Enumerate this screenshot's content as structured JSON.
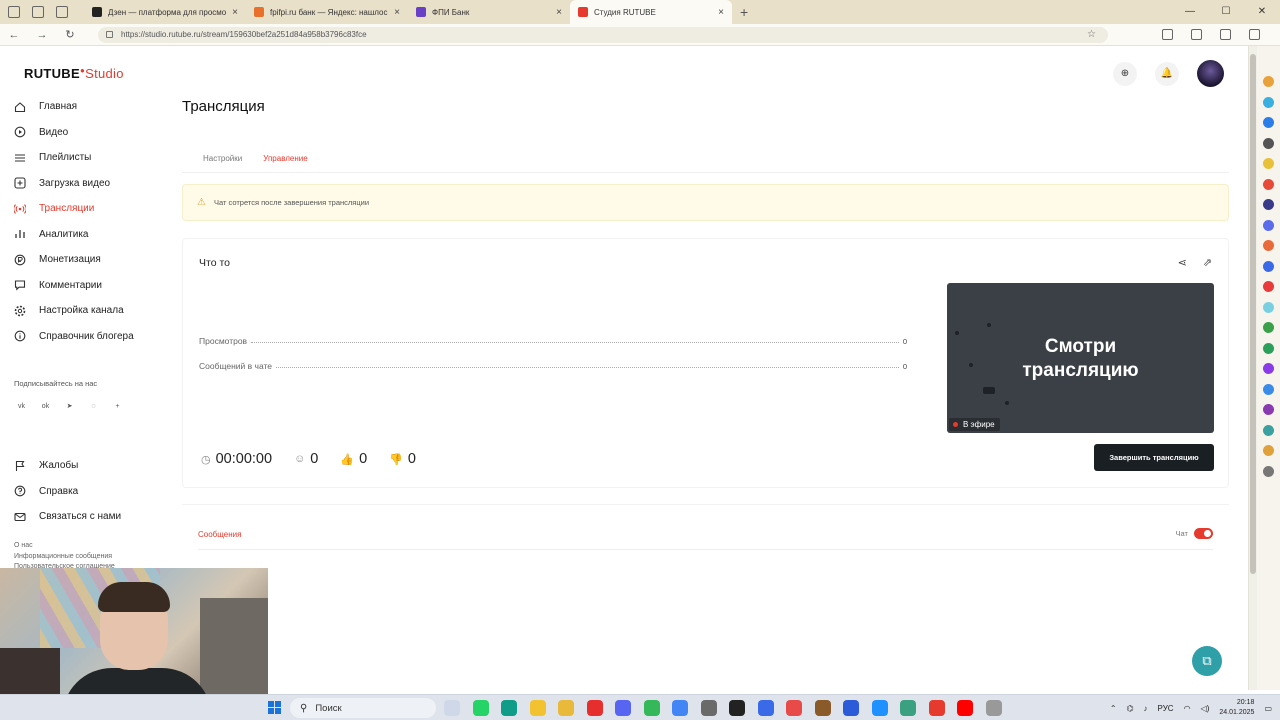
{
  "browser": {
    "tabs": [
      {
        "label": "Дзен — платформа для просмо",
        "color": "#222222",
        "active": false
      },
      {
        "label": "fpifpi.ru банк — Яндекс: нашлос",
        "color": "#e8702a",
        "active": false
      },
      {
        "label": "ФПИ Банк",
        "color": "#6a3fc7",
        "active": false
      },
      {
        "label": "Студия RUTUBE",
        "color": "#e63a2e",
        "active": true
      }
    ],
    "close_glyph": "×",
    "new_tab_glyph": "+",
    "url": "https://studio.rutube.ru/stream/159630bef2a251d84a958b3796c83fce",
    "window_controls": [
      "—",
      "☐",
      "✕"
    ]
  },
  "app": {
    "logo_main": "RUTUBE",
    "logo_dot": "●",
    "logo_studio": "Studio",
    "page_title": "Трансляция",
    "sidebar": [
      {
        "label": "Главная",
        "icon": "home-icon",
        "active": false
      },
      {
        "label": "Видео",
        "icon": "play-icon",
        "active": false
      },
      {
        "label": "Плейлисты",
        "icon": "list-icon",
        "active": false
      },
      {
        "label": "Загрузка видео",
        "icon": "upload-icon",
        "active": false
      },
      {
        "label": "Трансляции",
        "icon": "broadcast-icon",
        "active": true
      },
      {
        "label": "Аналитика",
        "icon": "analytics-icon",
        "active": false
      },
      {
        "label": "Монетизация",
        "icon": "monetization-icon",
        "active": false
      },
      {
        "label": "Комментарии",
        "icon": "comments-icon",
        "active": false
      },
      {
        "label": "Настройка канала",
        "icon": "settings-icon",
        "active": false
      },
      {
        "label": "Справочник блогера",
        "icon": "book-icon",
        "active": false
      }
    ],
    "follow_label": "Подписывайтесь на нас",
    "socials": [
      "vk",
      "ok",
      "telegram",
      "viber",
      "+"
    ],
    "sidebar_bottom": [
      {
        "label": "Жалобы",
        "icon": "flag-icon"
      },
      {
        "label": "Справка",
        "icon": "help-icon"
      },
      {
        "label": "Связаться с нами",
        "icon": "mail-icon"
      }
    ],
    "footer_links": [
      "О нас",
      "Информационные сообщения",
      "Пользовательское соглашение"
    ],
    "tabs": {
      "settings": "Настройки",
      "control": "Управление"
    },
    "warning": "Чат сотрется после завершения трансляции",
    "stream": {
      "title": "Что то",
      "views_label": "Просмотров",
      "views_value": "0",
      "chat_messages_label": "Сообщений в чате",
      "chat_messages_value": "0",
      "duration": "00:00:00",
      "viewers": "0",
      "likes": "0",
      "dislikes": "0",
      "preview_line1": "Смотри",
      "preview_line2": "трансляцию",
      "live_badge": "В эфире",
      "end_button": "Завершить трансляцию"
    },
    "messages_tab": "Сообщения",
    "chat_toggle_label": "Чат",
    "chat_enabled": true
  },
  "taskbar": {
    "search_label": "Поиск",
    "lang": "РУС",
    "time": "20:18",
    "date": "24.01.2025"
  }
}
